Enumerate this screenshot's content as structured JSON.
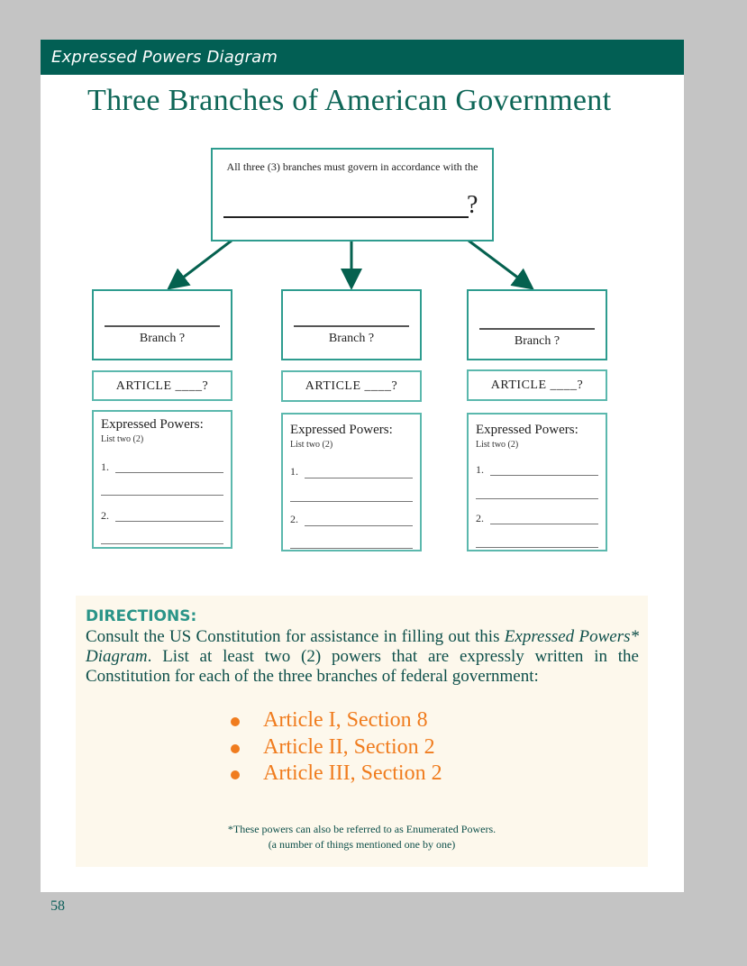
{
  "header": {
    "section_label": "Expressed Powers Diagram",
    "bar_color": "#025f54"
  },
  "title": "Three Branches of American Government",
  "diagram": {
    "top_box": {
      "text": "All three (3) branches must govern in accordance with the",
      "blank_suffix": "?"
    },
    "branches": [
      {
        "branch_label": "Branch ?",
        "article_label": "ARTICLE ____?",
        "powers_title": "Expressed Powers:",
        "powers_subtitle": "List two (2)",
        "item_numbers": [
          "1.",
          "2."
        ]
      },
      {
        "branch_label": "Branch ?",
        "article_label": "ARTICLE ____?",
        "powers_title": "Expressed Powers:",
        "powers_subtitle": "List two (2)",
        "item_numbers": [
          "1.",
          "2."
        ]
      },
      {
        "branch_label": "Branch ?",
        "article_label": "ARTICLE ____?",
        "powers_title": "Expressed Powers:",
        "powers_subtitle": "List two (2)",
        "item_numbers": [
          "1.",
          "2."
        ]
      }
    ],
    "accent_color": "#2e9c8f",
    "arrow_color": "#05614f"
  },
  "directions": {
    "heading": "DIRECTIONS:",
    "text_part1": "Consult the US Constitution for assistance in filling out this ",
    "text_italic": "Expressed Powers* Diagram",
    "text_part2": ".  List at least two (2) powers that are expressly written in the Constitution for each of the three branches of federal government:",
    "references": [
      "Article I, Section 8",
      "Article II, Section 2",
      "Article III, Section 2"
    ],
    "reference_color": "#f07c1e",
    "footnote_line1": "*These powers can also be referred to as Enumerated Powers.",
    "footnote_line2": "(a number of things mentioned one by one)"
  },
  "page_number": "58"
}
